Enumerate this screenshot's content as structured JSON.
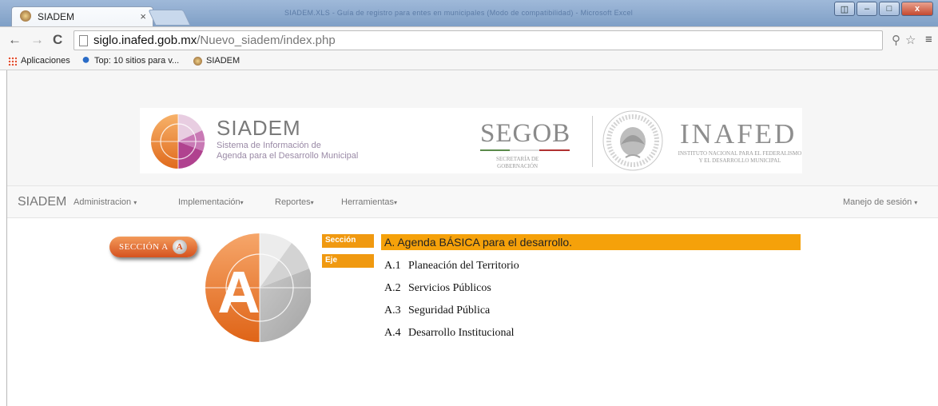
{
  "browser": {
    "tab_title": "SIADEM",
    "tab_close": "×",
    "window_title": "SIADEM.XLS - Guía de registro para entes en municipales (Modo de compatibilidad) - Microsoft Excel",
    "nav_back": "←",
    "nav_forward": "→",
    "nav_reload": "C",
    "url_host": "siglo.inafed.gob.mx",
    "url_path": "/Nuevo_siadem/index.php",
    "key_icon": "⚲",
    "star_icon": "☆",
    "menu_icon": "≡",
    "win_min": "–",
    "win_max": "□",
    "win_close": "x",
    "win_extra": "◫"
  },
  "bookmarks": [
    {
      "label": "Aplicaciones",
      "icon": "apps-icon"
    },
    {
      "label": "Top: 10 sitios para v...",
      "icon": "site-icon"
    },
    {
      "label": "SIADEM",
      "icon": "siadem-icon"
    }
  ],
  "banner": {
    "siadem_title": "SIADEM",
    "siadem_line1": "Sistema de Información de",
    "siadem_line2": "Agenda para el Desarrollo Municipal",
    "segob": "SEGOB",
    "segob_line1": "SECRETARÍA DE",
    "segob_line2": "GOBERNACIÓN",
    "inafed": "INAFED",
    "inafed_line1": "INSTITUTO NACIONAL PARA EL FEDERALISMO",
    "inafed_line2": "Y EL DESARROLLO MUNICIPAL"
  },
  "navbar": {
    "brand": "SIADEM",
    "items": [
      {
        "label": "Administracion"
      },
      {
        "label": "Implementación"
      },
      {
        "label": "Reportes"
      },
      {
        "label": "Herramientas"
      }
    ],
    "session": "Manejo de sesión",
    "caret": "▾"
  },
  "content": {
    "section_pill": "SECCIÓN A",
    "section_pill_letter": "A",
    "big_letter": "A",
    "seccion_label": "Sección",
    "eje_label": "Eje",
    "section_title": "A. Agenda BÁSICA para el desarrollo.",
    "ejes": [
      {
        "num": "A.1",
        "label": "Planeación del Territorio"
      },
      {
        "num": "A.2",
        "label": "Servicios Públicos"
      },
      {
        "num": "A.3",
        "label": "Seguridad Pública"
      },
      {
        "num": "A.4",
        "label": "Desarrollo Institucional"
      }
    ]
  },
  "colors": {
    "accent_orange": "#f5a10a",
    "label_orange": "#f09910",
    "pill_orange": "#d5521f",
    "siadem_purple": "#b0428f"
  }
}
